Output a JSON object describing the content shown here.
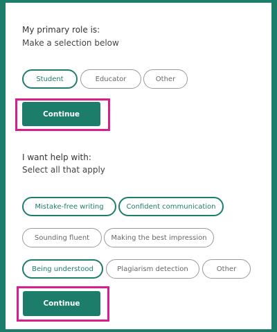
{
  "role_question": {
    "title": "My primary role is:",
    "subtitle": "Make a selection below",
    "options": [
      {
        "label": "Student",
        "selected": true
      },
      {
        "label": "Educator",
        "selected": false
      },
      {
        "label": "Other",
        "selected": false
      }
    ],
    "continue_label": "Continue"
  },
  "help_question": {
    "title": "I want help with:",
    "subtitle": "Select all that apply",
    "options": [
      {
        "label": "Mistake-free writing",
        "selected": true
      },
      {
        "label": "Confident communication",
        "selected": true
      },
      {
        "label": "Sounding fluent",
        "selected": false
      },
      {
        "label": "Making the best impression",
        "selected": false
      },
      {
        "label": "Being understood",
        "selected": true
      },
      {
        "label": "Plagiarism detection",
        "selected": false
      },
      {
        "label": "Other",
        "selected": false
      }
    ],
    "continue_label": "Continue"
  },
  "colors": {
    "accent": "#1d7d6b",
    "highlight": "#d91e8c",
    "frame": "#1d7d6b"
  }
}
